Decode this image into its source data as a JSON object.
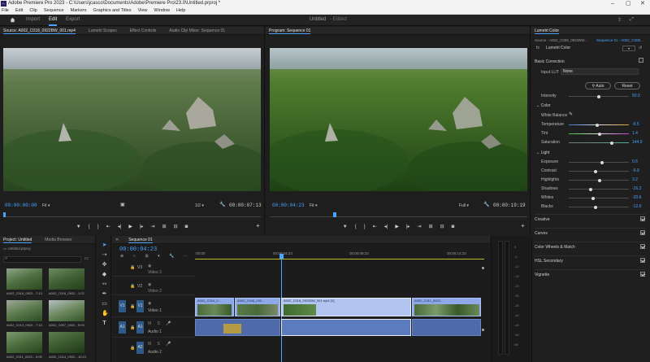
{
  "window": {
    "title": "Adobe Premiere Pro 2023 - C:\\Users\\jcasco\\Documents\\Adobe\\Premiere Pro\\23.0\\Untitled.prproj *"
  },
  "menu": [
    "File",
    "Edit",
    "Clip",
    "Sequence",
    "Markers",
    "Graphics and Titles",
    "View",
    "Window",
    "Help"
  ],
  "workspace": {
    "tabs": [
      "Import",
      "Edit",
      "Export"
    ],
    "active": "Edit",
    "project_name": "Untitled",
    "project_status": "- Edited"
  },
  "source_panel": {
    "tabs": [
      "Source: A002_C018_0922BW_001.mp4",
      "Lumetri Scopes",
      "Effect Controls",
      "Audio Clip Mixer: Sequence 01"
    ],
    "timecode_in": "00:00:00:00",
    "fit": "Fit",
    "resolution": "1/2",
    "timecode_out": "00:00:07:13"
  },
  "program_panel": {
    "tab": "Program: Sequence 01",
    "timecode_in": "00:00:04:23",
    "fit": "Fit",
    "resolution": "Full",
    "timecode_out": "00:00:19:19"
  },
  "project_panel": {
    "tabs": [
      "Project: Untitled",
      "Media Browser"
    ],
    "file": "Untitled.prproj",
    "items": [
      {
        "name": "A002_C018_0922...",
        "dur": "7:13"
      },
      {
        "name": "A002_C016_0922...",
        "dur": "1:22"
      },
      {
        "name": "A002_C013_0922...",
        "dur": "7:13"
      },
      {
        "name": "A002_C007_0922...",
        "dur": "5:03"
      },
      {
        "name": "A002_C011_0922...",
        "dur": "5:05"
      },
      {
        "name": "A002_C014_0922...",
        "dur": "10:13"
      }
    ]
  },
  "timeline": {
    "tab": "Sequence 01",
    "timecode": "00:00:04:23",
    "ruler": [
      ":00:00",
      "00:00:04:23",
      "00:00:09:23",
      "00:00:14:23"
    ],
    "tracks_video": [
      {
        "id": "V3",
        "name": "Video 3"
      },
      {
        "id": "V2",
        "name": "Video 2"
      },
      {
        "id": "V1",
        "name": "Video 1"
      }
    ],
    "tracks_audio": [
      {
        "id": "A1",
        "name": "Audio 1"
      },
      {
        "id": "A2",
        "name": "Audio 2"
      }
    ],
    "clips": [
      {
        "label": "A002_C004_0..."
      },
      {
        "label": "A002_C008_092..."
      },
      {
        "label": "A002_C018_0922BW_001.mp4 [V]"
      },
      {
        "label": "A002_C011_0922..."
      }
    ]
  },
  "lumetri": {
    "tab": "Lumetri Color",
    "source": "Source - A002_C008_0922BW...",
    "sequence": "Sequence 01 - A002_C008...",
    "effect": "Lumetri Color",
    "basic": "Basic Correction",
    "input_lut_label": "Input LUT",
    "input_lut_value": "None",
    "auto": "Auto",
    "reset": "Reset",
    "intensity": {
      "label": "Intensity",
      "value": "50.0",
      "pos": 0.5
    },
    "color_header": "Color",
    "white_balance": "White Balance",
    "color_sliders": [
      {
        "label": "Temperature",
        "value": "-9.5",
        "pos": 0.47
      },
      {
        "label": "Tint",
        "value": "1.4",
        "pos": 0.51
      },
      {
        "label": "Saturation",
        "value": "144.9",
        "pos": 0.72
      }
    ],
    "light_header": "Light",
    "light_sliders": [
      {
        "label": "Exposure",
        "value": "0.6",
        "pos": 0.55
      },
      {
        "label": "Contrast",
        "value": "-9.9",
        "pos": 0.45
      },
      {
        "label": "Highlights",
        "value": "3.2",
        "pos": 0.52
      },
      {
        "label": "Shadows",
        "value": "-26.2",
        "pos": 0.37
      },
      {
        "label": "Whites",
        "value": "-20.6",
        "pos": 0.4
      },
      {
        "label": "Blacks",
        "value": "-12.6",
        "pos": 0.44
      }
    ],
    "sections": [
      "Creative",
      "Curves",
      "Color Wheels & Match",
      "HSL Secondary",
      "Vignette"
    ]
  },
  "colors": {
    "accent": "#4aa3ff",
    "playhead": "#4aa3ff",
    "clip_video": "#8fa9e8",
    "clip_audio": "#5c7bbd"
  }
}
